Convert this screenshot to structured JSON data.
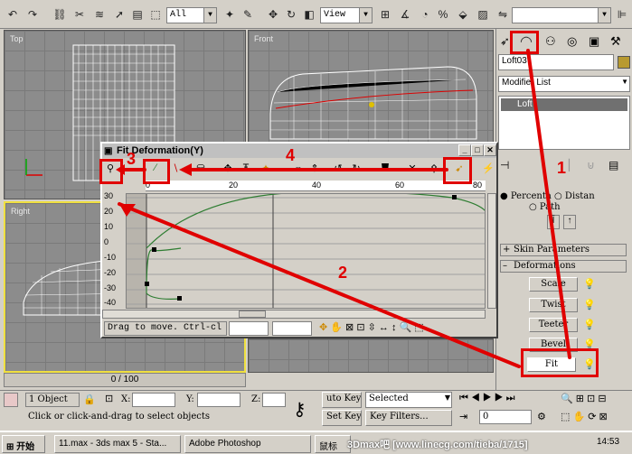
{
  "toolbar": {
    "selection_filter": "All",
    "coord_system": "View",
    "icons": [
      "undo-icon",
      "redo-icon",
      "link-icon",
      "unlink-icon",
      "bind-spacewarp-icon",
      "select-icon",
      "select-by-name-icon",
      "select-region-icon",
      "move-icon",
      "rotate-icon",
      "scale-icon",
      "mirror-icon",
      "align-icon",
      "named-sets-icon"
    ]
  },
  "viewports": {
    "top": {
      "label": "Top"
    },
    "front": {
      "label": "Front"
    },
    "right": {
      "label": "Right"
    },
    "timeline": "0 / 100"
  },
  "command_panel": {
    "object_name": "Loft03",
    "modifier_list": "Modifier List",
    "stack_item": "Loft",
    "radio_percent": "Percenta",
    "radio_distance": "Distan",
    "radio_path": "Path",
    "rollout_skin": "Skin Parameters",
    "rollout_deform": "Deformations",
    "btn_scale": "Scale",
    "btn_twist": "Twist",
    "btn_teeter": "Teeter",
    "btn_bevel": "Bevel",
    "btn_fit": "Fit"
  },
  "dialog": {
    "title": "Fit Deformation(Y)",
    "ruler_ticks": [
      "0",
      "20",
      "40",
      "60",
      "80"
    ],
    "y_ticks": [
      "30",
      "20",
      "10",
      "0",
      "-10",
      "-20",
      "-30",
      "-40"
    ],
    "status": "Drag to move. Ctrl-cl"
  },
  "annotations": {
    "label1": "1",
    "label2": "2",
    "label3": "3",
    "label4": "4"
  },
  "statusbar": {
    "object_count": "1 Object",
    "x_label": "X:",
    "y_label": "Y:",
    "z_label": "Z:",
    "prompt": "Click or click-and-drag to select objects",
    "autokey": "uto Key",
    "setkey": "Set Key",
    "selected": "Selected",
    "key_filters": "Key Filters...",
    "frame": "0"
  },
  "taskbar": {
    "start": "开始",
    "item1": "11.max - 3ds max 5 - Sta...",
    "item2": "Adobe Photoshop",
    "item3": "鼠标",
    "watermark": "3Dmax吧 [www.linecg.com/tieba/1715]",
    "clock": "14:53"
  },
  "colors": {
    "annotation_red": "#e00000",
    "viewport_bg": "#8c8c8c",
    "active_viewport_border": "#f0e040",
    "curve_green": "#2e7d32",
    "ui_face": "#d4d0c8"
  }
}
